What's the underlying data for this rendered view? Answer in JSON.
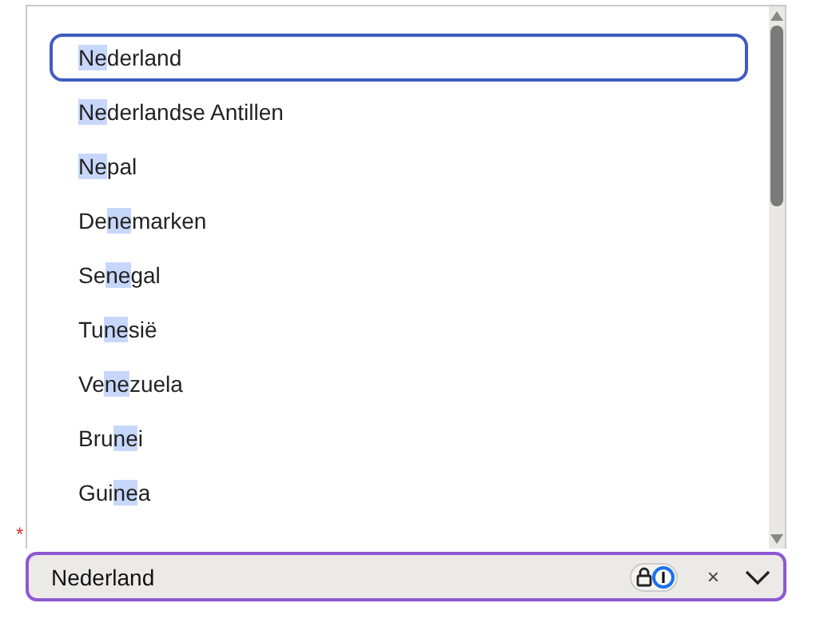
{
  "options": [
    {
      "match": "Ne",
      "after": "derland",
      "selected": true
    },
    {
      "match": "Ne",
      "after": "derlandse Antillen",
      "selected": false
    },
    {
      "match": "Ne",
      "after": "pal",
      "selected": false
    },
    {
      "before": "De",
      "match": "ne",
      "after": "marken",
      "selected": false
    },
    {
      "before": "Se",
      "match": "ne",
      "after": "gal",
      "selected": false
    },
    {
      "before": "Tu",
      "match": "ne",
      "after": "sië",
      "selected": false
    },
    {
      "before": "Ve",
      "match": "ne",
      "after": "zuela",
      "selected": false
    },
    {
      "before": "Bru",
      "match": "ne",
      "after": "i",
      "selected": false
    },
    {
      "before": "Gui",
      "match": "ne",
      "after": "a",
      "selected": false
    }
  ],
  "required_mark": "*",
  "combobox": {
    "value": "Nederland",
    "clear": "×"
  }
}
